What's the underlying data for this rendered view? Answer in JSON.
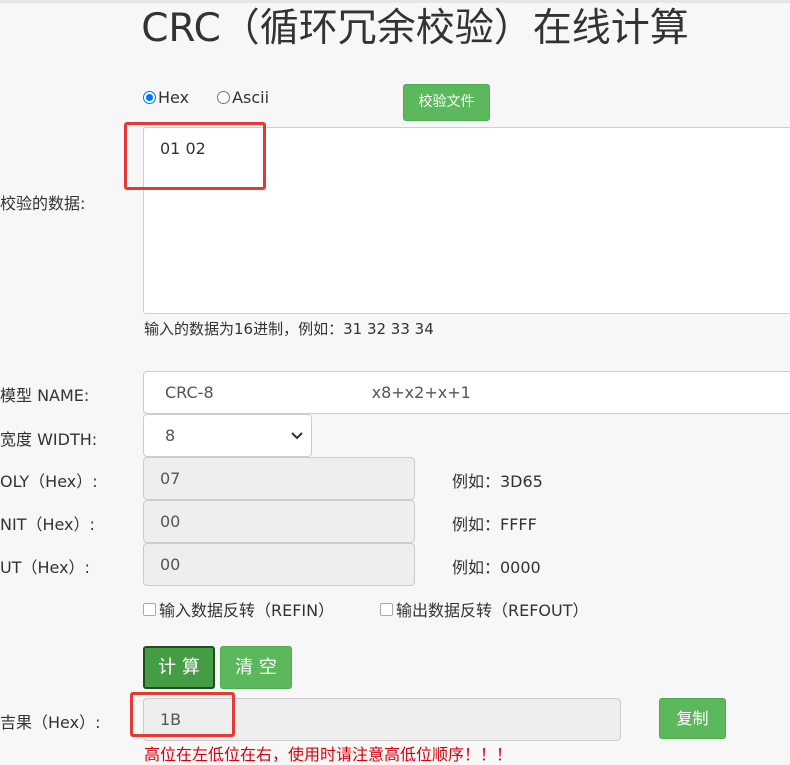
{
  "page": {
    "title": "CRC（循环冗余校验）在线计算"
  },
  "input_mode": {
    "options": [
      "Hex",
      "Ascii"
    ],
    "selected": "Hex",
    "verify_file_label": "校验文件"
  },
  "data_input": {
    "label": "校验的数据:",
    "value": "01 02",
    "hint": "输入的数据为16进制，例如：31 32 33 34"
  },
  "params": {
    "name_label": "模型 NAME:",
    "name_value": "CRC-8",
    "polynomial": "x8+x2+x+1",
    "width_label": "宽度 WIDTH:",
    "width_value": "8",
    "poly_label": "OLY（Hex）:",
    "poly_value": "07",
    "poly_example": "例如：3D65",
    "init_label": "NIT（Hex）:",
    "init_value": "00",
    "init_example": "例如：FFFF",
    "xorout_label": "UT（Hex）:",
    "xorout_value": "00",
    "xorout_example": "例如：0000",
    "refin_label": "输入数据反转（REFIN）",
    "refout_label": "输出数据反转（REFOUT）"
  },
  "actions": {
    "calc_label": "计 算",
    "clear_label": "清 空"
  },
  "result": {
    "label": "吉果（Hex）:",
    "value": "1B",
    "copy_label": "复制",
    "warning": "高位在左低位在右，使用时请注意高低位顺序！！！"
  },
  "colors": {
    "green": "#5cb85c",
    "dark_green": "#3c8a3c",
    "highlight_red": "#e53935",
    "warning_red": "#d9000d"
  }
}
